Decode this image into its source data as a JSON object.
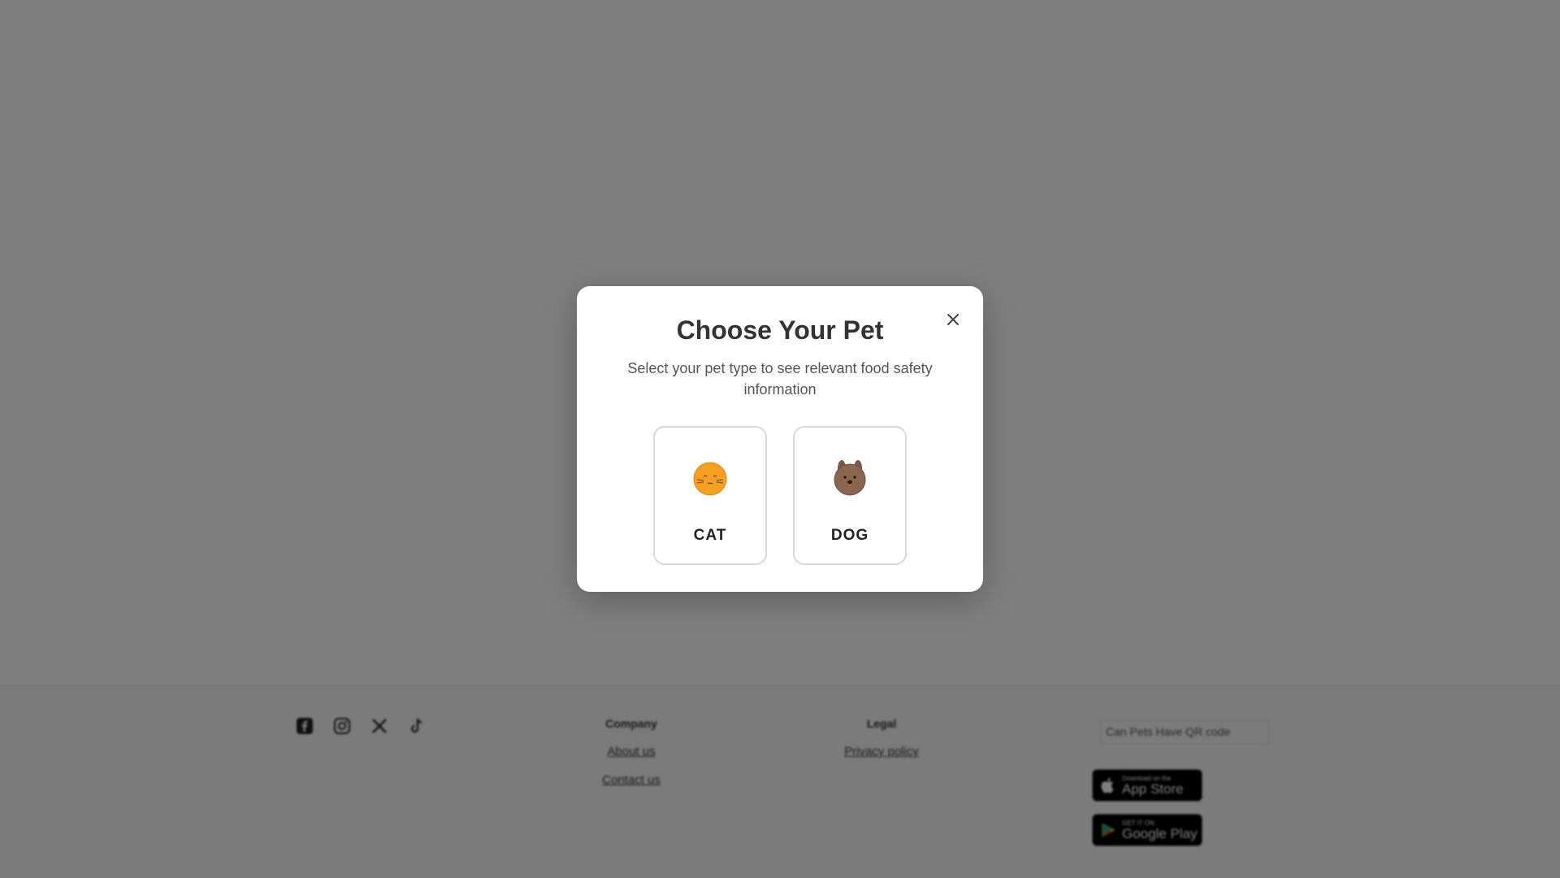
{
  "background": {
    "social_icons": [
      "facebook-icon",
      "instagram-icon",
      "x-icon",
      "tiktok-icon"
    ],
    "footer": {
      "company": {
        "heading": "Company",
        "links": [
          "About us",
          "Contact us"
        ]
      },
      "legal": {
        "heading": "Legal",
        "links": [
          "Privacy policy"
        ]
      },
      "qr_alt": "Can Pets Have QR code",
      "app_store": {
        "small": "Download on the",
        "big": "App Store"
      },
      "google_play": {
        "small": "GET IT ON",
        "big": "Google Play"
      }
    }
  },
  "modal": {
    "title": "Choose Your Pet",
    "subtitle": "Select your pet type to see relevant food safety information",
    "close_icon": "close-icon",
    "options": [
      {
        "label": "CAT",
        "icon": "cat-face-icon",
        "color": "#f5a020"
      },
      {
        "label": "DOG",
        "icon": "dog-face-icon",
        "color": "#8a6550"
      }
    ]
  },
  "colors": {
    "overlay": "rgba(0,0,0,0.5)",
    "modal_bg": "#ffffff",
    "card_border": "#d8d8d8"
  }
}
